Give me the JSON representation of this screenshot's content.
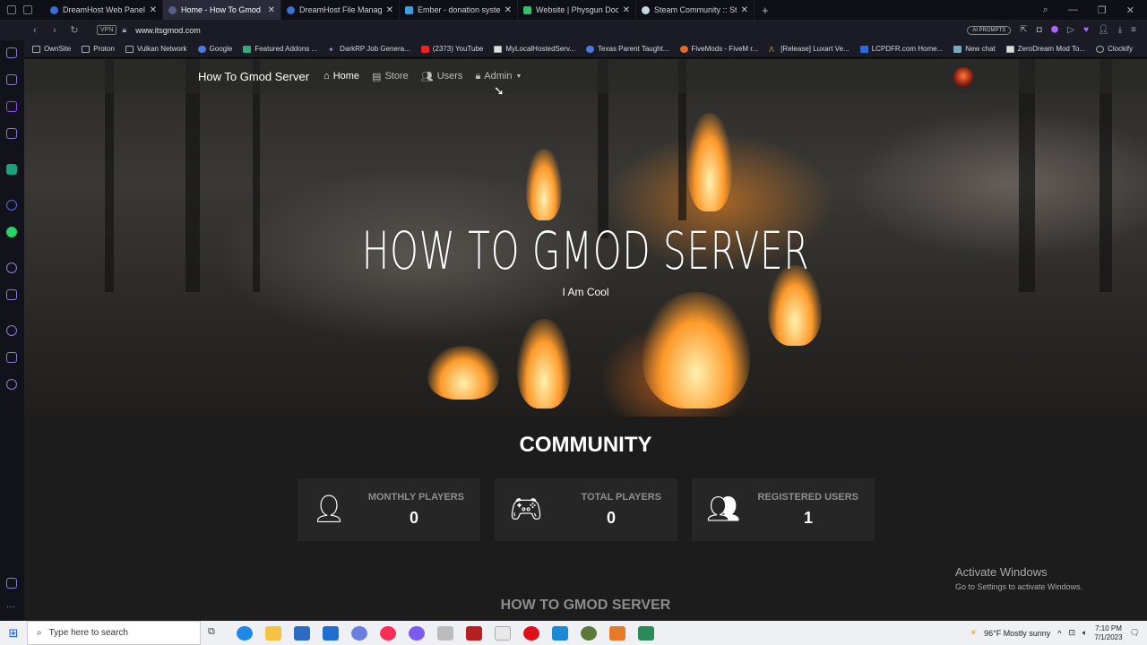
{
  "browser": {
    "tabs": [
      {
        "title": "DreamHost Web Panel > W",
        "active": false
      },
      {
        "title": "Home - How To Gmod Serv",
        "active": true
      },
      {
        "title": "DreamHost File Manager",
        "active": false
      },
      {
        "title": "Ember - donation system,",
        "active": false
      },
      {
        "title": "Website | Physgun Doc",
        "active": false
      },
      {
        "title": "Steam Community :: Steam",
        "active": false
      }
    ],
    "vpn_label": "VPN",
    "url": "www.itsgmod.com",
    "ai_prompts_label": "AI PROMPTS",
    "bookmarks": [
      "OwnSite",
      "Proton",
      "Vulkan Network",
      "Google",
      "Featured Addons ...",
      "DarkRP Job Genera...",
      "(2373) YouTube",
      "MyLocalHostedServ...",
      "Texas Parent Taught...",
      "FiveMods - FiveM r...",
      "[Release] Luxart Ve...",
      "LCPDFR.com Home...",
      "New chat",
      "ZeroDream Mod To...",
      "Clockify"
    ]
  },
  "site": {
    "brand": "How To Gmod Server",
    "nav": {
      "home": "Home",
      "store": "Store",
      "users": "Users",
      "admin": "Admin"
    },
    "hero_title": "HOW TO GMOD SERVER",
    "hero_subtitle": "I Am Cool",
    "community_heading": "COMMUNITY",
    "stats": [
      {
        "label": "MONTHLY PLAYERS",
        "value": "0",
        "icon": "user-clock-icon"
      },
      {
        "label": "TOTAL PLAYERS",
        "value": "0",
        "icon": "gamepad-icon"
      },
      {
        "label": "REGISTERED USERS",
        "value": "1",
        "icon": "users-icon"
      }
    ],
    "footer_heading": "HOW TO GMOD SERVER"
  },
  "windows_activation": {
    "line1": "Activate Windows",
    "line2": "Go to Settings to activate Windows."
  },
  "taskbar": {
    "search_placeholder": "Type here to search",
    "weather": "96°F  Mostly sunny",
    "time": "7:10 PM",
    "date": "7/1/2023"
  },
  "colors": {
    "accent_purple": "#b565ff",
    "card_bg": "#262626",
    "stat_label": "#8f8f8f"
  }
}
